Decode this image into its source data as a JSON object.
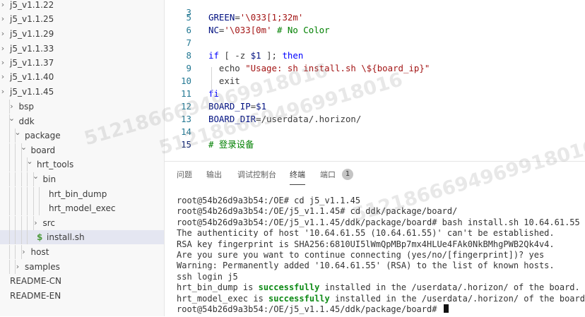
{
  "sidebar": {
    "items": [
      {
        "label": "j5_v1.1.22",
        "depth": 0,
        "chevron": ">"
      },
      {
        "label": "j5_v1.1.25",
        "depth": 0,
        "chevron": ">"
      },
      {
        "label": "j5_v1.1.29",
        "depth": 0,
        "chevron": ">"
      },
      {
        "label": "j5_v1.1.33",
        "depth": 0,
        "chevron": ">"
      },
      {
        "label": "j5_v1.1.37",
        "depth": 0,
        "chevron": ">"
      },
      {
        "label": "j5_v1.1.40",
        "depth": 0,
        "chevron": ">"
      },
      {
        "label": "j5_v1.1.45",
        "depth": 0,
        "chevron": ">"
      },
      {
        "label": "bsp",
        "depth": 1,
        "chevron": ">"
      },
      {
        "label": "ddk",
        "depth": 1,
        "chevron": "v"
      },
      {
        "label": "package",
        "depth": 2,
        "chevron": "v"
      },
      {
        "label": "board",
        "depth": 3,
        "chevron": "v"
      },
      {
        "label": "hrt_tools",
        "depth": 4,
        "chevron": "v"
      },
      {
        "label": "bin",
        "depth": 5,
        "chevron": "v"
      },
      {
        "label": "hrt_bin_dump",
        "depth": 6,
        "chevron": ""
      },
      {
        "label": "hrt_model_exec",
        "depth": 6,
        "chevron": ""
      },
      {
        "label": "src",
        "depth": 5,
        "chevron": ">"
      },
      {
        "label": "install.sh",
        "depth": 4,
        "chevron": "",
        "icon": "$",
        "selected": true
      },
      {
        "label": "host",
        "depth": 3,
        "chevron": ">"
      },
      {
        "label": "samples",
        "depth": 2,
        "chevron": ">"
      },
      {
        "label": "README-CN",
        "depth": 0,
        "chevron": ""
      },
      {
        "label": "README-EN",
        "depth": 0,
        "chevron": ""
      }
    ]
  },
  "editor": {
    "lines": [
      {
        "n": "5",
        "tokens": [
          [
            "v",
            "GREEN"
          ],
          [
            "p",
            "="
          ],
          [
            "s",
            "'\\033[1;32m'"
          ]
        ]
      },
      {
        "n": "6",
        "tokens": [
          [
            "v",
            "NC"
          ],
          [
            "p",
            "="
          ],
          [
            "s",
            "'\\033[0m'"
          ],
          [
            "p",
            " "
          ],
          [
            "c",
            "# No Color"
          ]
        ]
      },
      {
        "n": "7",
        "tokens": []
      },
      {
        "n": "8",
        "tokens": [
          [
            "k",
            "if"
          ],
          [
            "p",
            " [ -z "
          ],
          [
            "v",
            "$1"
          ],
          [
            "p",
            " ]; "
          ],
          [
            "k",
            "then"
          ]
        ]
      },
      {
        "n": "9",
        "tokens": [
          [
            "p",
            "  echo "
          ],
          [
            "s",
            "\"Usage: sh install.sh \\${board_ip}\""
          ]
        ]
      },
      {
        "n": "10",
        "tokens": [
          [
            "p",
            "  exit"
          ]
        ]
      },
      {
        "n": "11",
        "tokens": [
          [
            "k",
            "fi"
          ]
        ]
      },
      {
        "n": "12",
        "tokens": [
          [
            "v",
            "BOARD_IP"
          ],
          [
            "p",
            "="
          ],
          [
            "v",
            "$1"
          ]
        ]
      },
      {
        "n": "13",
        "tokens": [
          [
            "v",
            "BOARD_DIR"
          ],
          [
            "p",
            "=/userdata/.horizon/"
          ]
        ]
      },
      {
        "n": "14",
        "tokens": []
      },
      {
        "n": "15",
        "tokens": [
          [
            "c",
            "# 登录设备"
          ]
        ],
        "current": true
      }
    ]
  },
  "panel": {
    "tabs": [
      {
        "label": "问题",
        "active": false
      },
      {
        "label": "输出",
        "active": false
      },
      {
        "label": "调试控制台",
        "active": false
      },
      {
        "label": "终端",
        "active": true
      },
      {
        "label": "端口",
        "active": false
      }
    ],
    "ports_badge": "1"
  },
  "terminal": {
    "lines": [
      [
        [
          "n",
          "root@54b26d9a3b54:/OE# cd j5_v1.1.45"
        ]
      ],
      [
        [
          "n",
          "root@54b26d9a3b54:/OE/j5_v1.1.45# cd ddk/package/board/"
        ]
      ],
      [
        [
          "n",
          "root@54b26d9a3b54:/OE/j5_v1.1.45/ddk/package/board# bash install.sh 10.64.61.55"
        ]
      ],
      [
        [
          "n",
          "The authenticity of host '10.64.61.55 (10.64.61.55)' can't be established."
        ]
      ],
      [
        [
          "n",
          "RSA key fingerprint is SHA256:6810UI5lWmQpMBp7mx4HLUe4FAk0NkBMhgPWB2Qk4v4."
        ]
      ],
      [
        [
          "n",
          "Are you sure you want to continue connecting (yes/no/[fingerprint])? yes"
        ]
      ],
      [
        [
          "n",
          "Warning: Permanently added '10.64.61.55' (RSA) to the list of known hosts."
        ]
      ],
      [
        [
          "n",
          "ssh login j5"
        ]
      ],
      [
        [
          "n",
          "hrt_bin_dump is "
        ],
        [
          "g",
          "successfully"
        ],
        [
          "n",
          " installed in the /userdata/.horizon/ of the board."
        ]
      ],
      [
        [
          "n",
          "hrt_model_exec is "
        ],
        [
          "g",
          "successfully"
        ],
        [
          "n",
          " installed in the /userdata/.horizon/ of the board."
        ]
      ],
      [
        [
          "n",
          "root@54b26d9a3b54:/OE/j5_v1.1.45/ddk/package/board# "
        ]
      ]
    ]
  },
  "watermark": "5121866694969918016",
  "colors": {
    "keyword": "#0000ff",
    "string": "#a31515",
    "comment": "#008000",
    "success": "#0e8a16"
  }
}
